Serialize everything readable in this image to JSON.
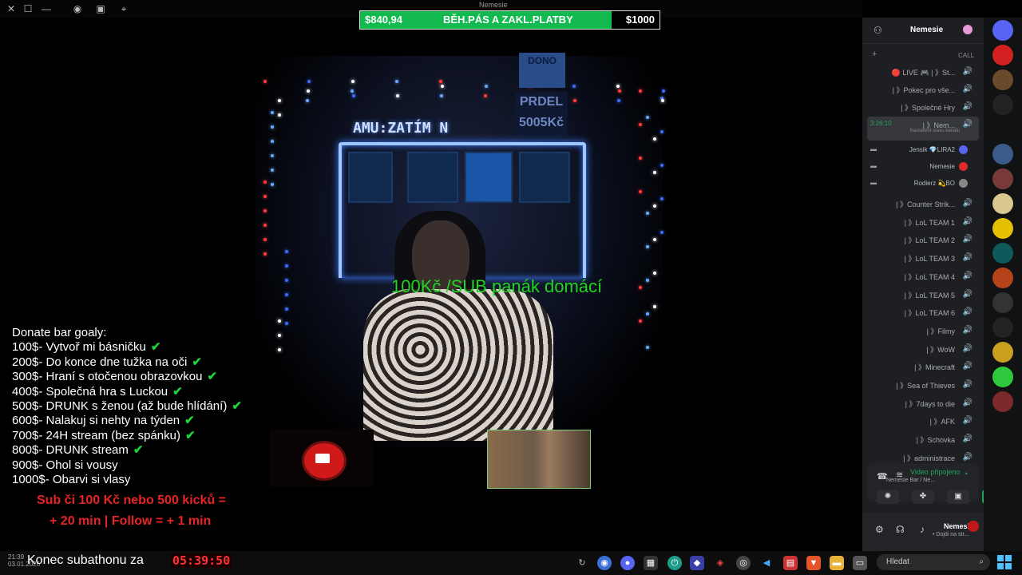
{
  "window": {
    "title": "Nemesie"
  },
  "goal_bar": {
    "current": "$840,94",
    "title": "BĚH.PÁS A ZAKL.PLATBY",
    "target": "$1000",
    "progress": 0.84,
    "fill_color": "#12b94f"
  },
  "scene": {
    "neon_sign": "AMU:ZATÍM N",
    "poster_top": "DONO",
    "poster_bottom": "PRDEL 5005Kč",
    "overlay_text": "100Kč /SUB panák domácí"
  },
  "donate": {
    "title": "Donate bar goaly:",
    "goals": [
      {
        "text": "100$- Vytvoř mi básničku",
        "done": true
      },
      {
        "text": "200$- Do konce dne tužka na oči",
        "done": true
      },
      {
        "text": "300$- Hraní s otočenou obrazovkou",
        "done": true
      },
      {
        "text": "400$- Společná hra s Luckou",
        "done": true
      },
      {
        "text": "500$- DRUNK s ženou (až bude hlídání)",
        "done": true
      },
      {
        "text": "600$- Nalakuj si nehty na týden",
        "done": true
      },
      {
        "text": "700$- 24H stream (bez spánku)",
        "done": true
      },
      {
        "text": "800$-  DRUNK stream",
        "done": true
      },
      {
        "text": "900$- Ohol si vousy",
        "done": false
      },
      {
        "text": "1000$- Obarvi si vlasy",
        "done": false
      }
    ],
    "check_glyph": "✔",
    "sub_line1": "Sub či 100 Kč nebo 500 kicků =",
    "sub_line2": "+ 20 min | Follow = + 1 min"
  },
  "subathon": {
    "label": "Konec subathonu za",
    "timer": "05:39:50"
  },
  "clock": {
    "time": "21:39",
    "date": "03.01.2026"
  },
  "taskbar": {
    "search_placeholder": "Hledat"
  },
  "discord": {
    "server_name": "Nemesie",
    "call_label": "CALL",
    "channels": [
      {
        "label": "🔴 LIVE 🎮 | 》St...",
        "icon": "🔊"
      },
      {
        "label": "| 》Pokec pro vše...",
        "icon": "🔊"
      },
      {
        "label": "| 》Společné Hry",
        "icon": "🔊"
      },
      {
        "label": "| 》Nem...",
        "icon": "🔊",
        "timer": "3:26:10",
        "sub": "Nastavení stavu kanálu"
      }
    ],
    "members": [
      {
        "name": "Jensik 💎LIRA2",
        "color": "#5865f2"
      },
      {
        "name": "Nemesie",
        "color": "#e02b2b"
      },
      {
        "name": "Rodierz 💫BO",
        "color": "#888888"
      }
    ],
    "channels2": [
      "| 》Counter Strik...",
      "| 》LoL TEAM 1",
      "| 》LoL TEAM 2",
      "| 》LoL TEAM 3",
      "| 》LoL TEAM 4",
      "| 》LoL TEAM 5",
      "| 》LoL TEAM 6",
      "| 》Filmy",
      "| 》WoW",
      "| 》Minecraft",
      "| 》Sea of Thieves",
      "| 》7days to die",
      "| 》AFK",
      "| 》Schovka",
      "| 》administrace"
    ],
    "voice_status": "Video připojeno",
    "voice_sub": "Nemesie Bar / Ne...",
    "user_name": "Nemesie",
    "user_sub": "• Dojdi na str..."
  }
}
